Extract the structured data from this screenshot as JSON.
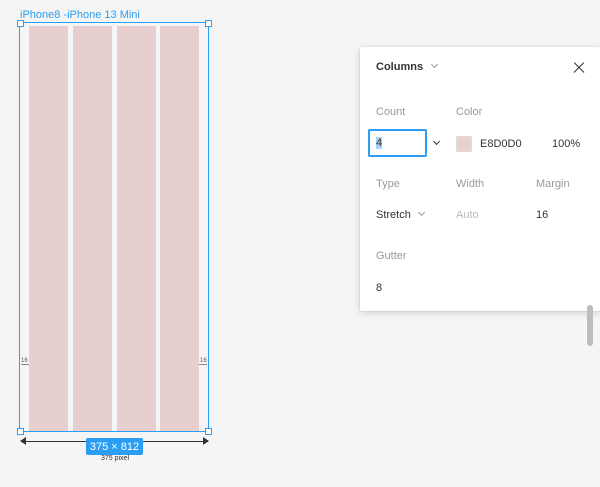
{
  "canvas": {
    "frame_label": "iPhone8 -iPhone 13 Mini",
    "size_badge": "375 × 812",
    "width_label": "375 pixel",
    "margin_left": "16",
    "margin_right": "16",
    "column_color": "#E6CFCE",
    "selection_color": "#2A9DF4"
  },
  "panel": {
    "title": "Columns",
    "count": {
      "label": "Count",
      "value": "4"
    },
    "color": {
      "label": "Color",
      "hex": "E8D0D0",
      "opacity": "100%",
      "swatch": "#E8D0D0"
    },
    "type": {
      "label": "Type",
      "value": "Stretch"
    },
    "width": {
      "label": "Width",
      "placeholder": "Auto"
    },
    "margin": {
      "label": "Margin",
      "value": "16"
    },
    "gutter": {
      "label": "Gutter",
      "value": "8"
    }
  }
}
